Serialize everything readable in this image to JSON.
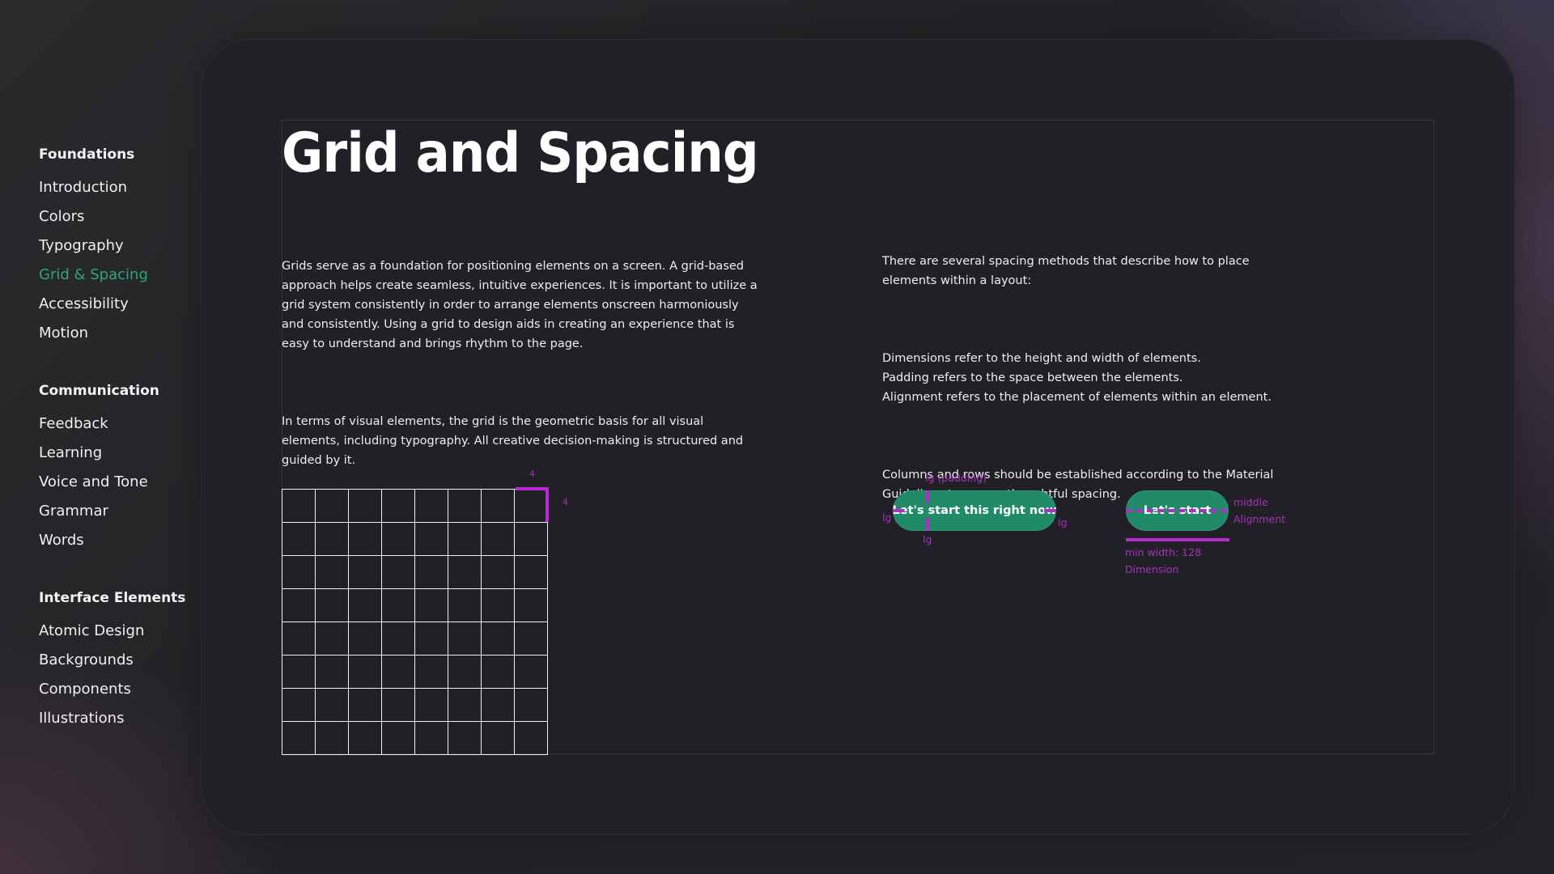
{
  "sidebar": {
    "groups": [
      {
        "title": "Foundations",
        "items": [
          "Introduction",
          "Colors",
          "Typography",
          "Grid & Spacing",
          "Accessibility",
          "Motion"
        ]
      },
      {
        "title": "Communication",
        "items": [
          "Feedback",
          "Learning",
          "Voice and Tone",
          "Grammar",
          "Words"
        ]
      },
      {
        "title": "Interface Elements",
        "items": [
          "Atomic Design",
          "Backgrounds",
          "Components",
          "Illustrations"
        ]
      }
    ],
    "active_item": "Grid & Spacing"
  },
  "main": {
    "title": "Grid and Spacing",
    "left_paragraphs": [
      "Grids serve as a foundation for positioning elements on a screen. A grid-based approach helps create seamless, intuitive experiences. It is important to utilize a grid system consistently in order to arrange elements onscreen harmoniously and consistently. Using a grid to design aids in creating an experience that is easy to understand and brings rhythm to the page.",
      "In terms of visual elements, the grid is the geometric basis for all visual elements, including typography. All creative decision-making is structured and guided by it."
    ],
    "right_paragraphs": [
      "There are several spacing methods that describe how to place elements within a layout:",
      "Dimensions refer to the height and width of elements.\nPadding refers to the space between the elements.\nAlignment refers to the placement of elements within an element.",
      "Columns and rows should be established according to the Material Guidelines to ensure thoughtful spacing."
    ],
    "grid_demo": {
      "columns": 8,
      "rows": 8,
      "unit_label_top": "4",
      "unit_label_side": "4"
    },
    "padding_demo": {
      "button_label": "Let's start this right now",
      "label_top": "lg (padding)",
      "label_left": "lg",
      "label_right": "lg",
      "label_bottom": "lg"
    },
    "alignment_demo": {
      "button_label": "Let's start",
      "alignment_value": "middle",
      "alignment_label": "Alignment",
      "dimension_value": "min width: 128",
      "dimension_label": "Dimension"
    }
  },
  "colors": {
    "accent_green": "#2ea57f",
    "button_green": "#218a69",
    "annotation_magenta": "#b42ccc"
  }
}
